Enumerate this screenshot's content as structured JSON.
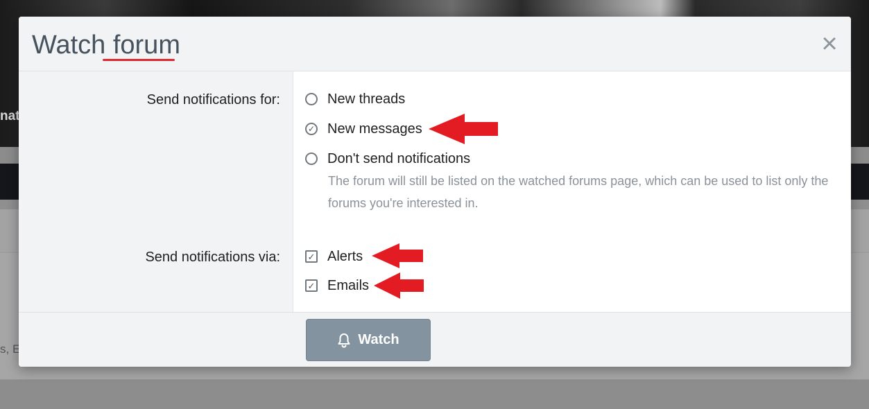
{
  "background": {
    "banner_text": "nat",
    "panel_text": "s, E"
  },
  "modal": {
    "title": "Watch forum",
    "close_icon": "close-icon",
    "rows": {
      "notifications_for": {
        "label": "Send notifications for:",
        "options": [
          {
            "label": "New threads",
            "selected": false
          },
          {
            "label": "New messages",
            "selected": true
          },
          {
            "label": "Don't send notifications",
            "selected": false
          }
        ],
        "hint": "The forum will still be listed on the watched forums page, which can be used to list only the forums you're interested in."
      },
      "notifications_via": {
        "label": "Send notifications via:",
        "options": [
          {
            "label": "Alerts",
            "checked": true
          },
          {
            "label": "Emails",
            "checked": true
          }
        ]
      }
    },
    "footer": {
      "watch_label": "Watch",
      "watch_icon": "bell-icon"
    }
  },
  "colors": {
    "annotation_red": "#e31b23",
    "button_bg": "#8493a0",
    "title_underline": "#e0262c"
  }
}
